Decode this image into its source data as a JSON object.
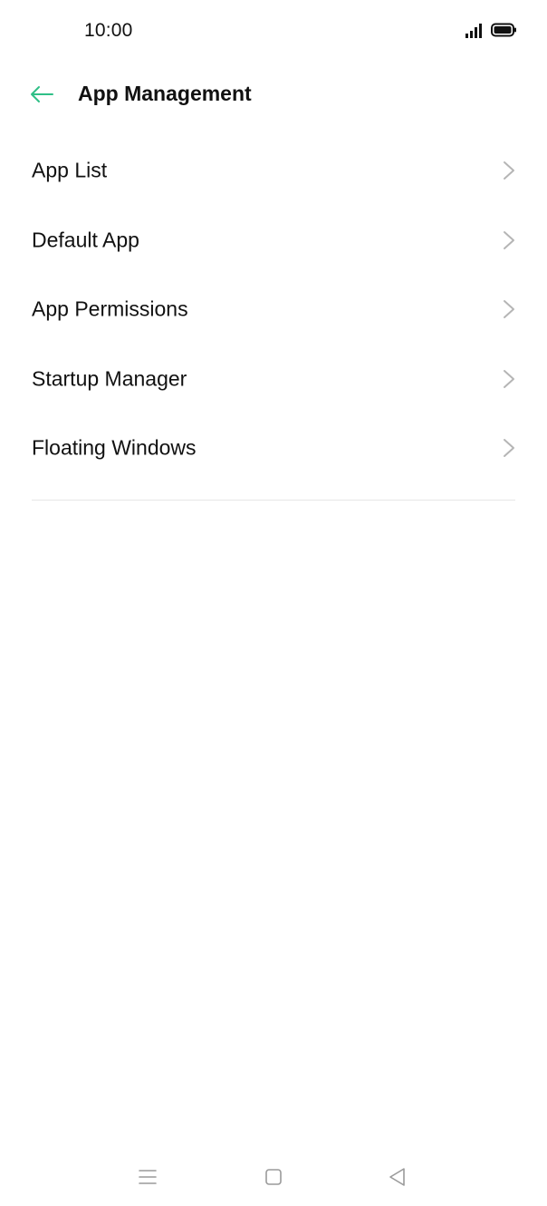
{
  "status_bar": {
    "time": "10:00",
    "icons": [
      "signal-icon",
      "battery-icon"
    ]
  },
  "header": {
    "title": "App Management",
    "back_icon": "arrow-left-icon",
    "accent_color": "#2fbf87"
  },
  "menu": {
    "items": [
      {
        "label": "App List"
      },
      {
        "label": "Default App"
      },
      {
        "label": "App Permissions"
      },
      {
        "label": "Startup Manager"
      },
      {
        "label": "Floating Windows"
      }
    ],
    "chevron_icon": "chevron-right-icon"
  },
  "nav_bar": {
    "icons": [
      "recents-menu-icon",
      "home-square-icon",
      "back-triangle-icon"
    ]
  }
}
